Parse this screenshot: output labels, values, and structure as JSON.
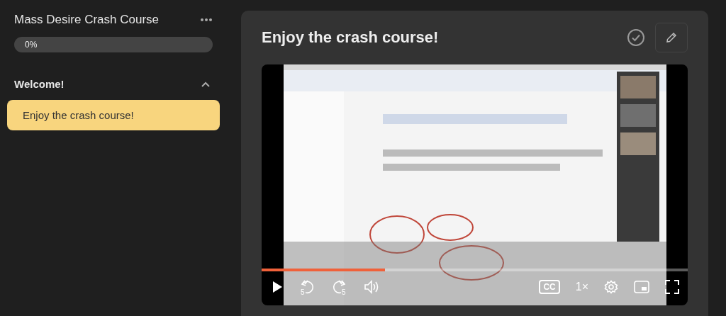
{
  "sidebar": {
    "course_title": "Mass Desire Crash Course",
    "progress": {
      "label": "0%",
      "level": 0
    },
    "sections": [
      {
        "title": "Welcome!",
        "expanded": true,
        "lessons": [
          {
            "title": "Enjoy the crash course!",
            "selected": true
          }
        ]
      }
    ]
  },
  "lesson": {
    "title": "Enjoy the crash course!",
    "completed": false,
    "video": {
      "playing": false,
      "level": 0.29,
      "rewind_label": "5",
      "forward_label": "5",
      "captions_label": "CC",
      "speed_label": "1×"
    }
  }
}
